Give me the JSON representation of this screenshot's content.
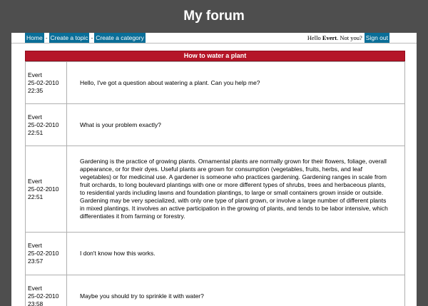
{
  "site": {
    "title": "My forum"
  },
  "nav": {
    "items": [
      {
        "label": "Home"
      },
      {
        "label": "Create a topic"
      },
      {
        "label": "Create a category"
      }
    ],
    "separator": "-"
  },
  "userbar": {
    "greeting": "Hello",
    "username": "Evert",
    "suffix": ". Not you?",
    "signout_label": "Sign out"
  },
  "topic": {
    "title": "How to water a plant",
    "posts": [
      {
        "author": "Evert",
        "date": "25-02-2010",
        "time": "22:35",
        "content": "Hello, I've got a question about watering a plant. Can you help me?"
      },
      {
        "author": "Evert",
        "date": "25-02-2010",
        "time": "22:51",
        "content": "What is your problem exactly?"
      },
      {
        "author": "Evert",
        "date": "25-02-2010",
        "time": "22:51",
        "content": "Gardening is the practice of growing plants. Ornamental plants are normally grown for their flowers, foliage, overall appearance, or for their dyes. Useful plants are grown for consumption (vegetables, fruits, herbs, and leaf vegetables) or for medicinal use. A gardener is someone who practices gardening. Gardening ranges in scale from fruit orchards, to long boulevard plantings with one or more different types of shrubs, trees and herbaceous plants, to residential yards including lawns and foundation plantings, to large or small containers grown inside or outside. Gardening may be very specialized, with only one type of plant grown, or involve a large number of different plants in mixed plantings. It involves an active participation in the growing of plants, and tends to be labor intensive, which differentiates it from farming or forestry."
      },
      {
        "author": "Evert",
        "date": "25-02-2010",
        "time": "23:57",
        "content": "I don't know how this works."
      },
      {
        "author": "Evert",
        "date": "25-02-2010",
        "time": "23:58",
        "content": "Maybe you should try to sprinkle it with water?"
      }
    ]
  },
  "colors": {
    "page_background": "#4e4e4e",
    "nav_button": "#0a6e98",
    "topic_header": "#b51628"
  }
}
